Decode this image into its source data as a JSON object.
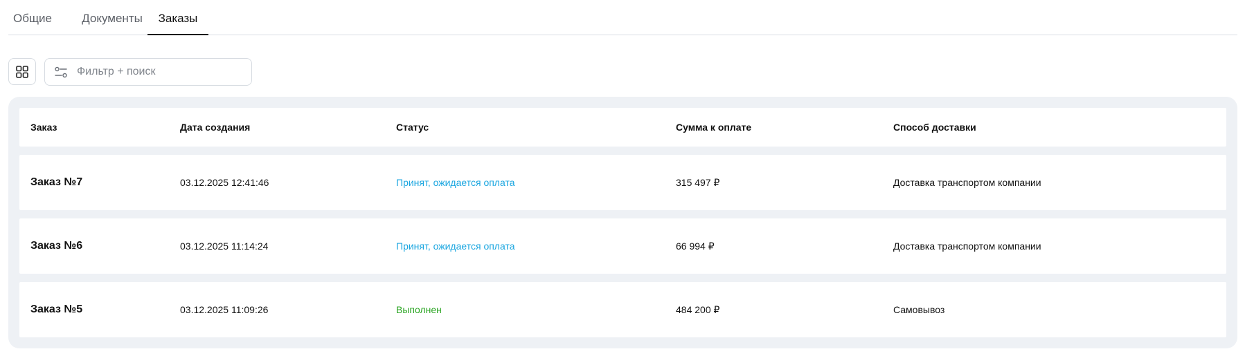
{
  "tabs": [
    {
      "label": "Общие",
      "active": false
    },
    {
      "label": "Документы",
      "active": false
    },
    {
      "label": "Заказы",
      "active": true
    }
  ],
  "toolbar": {
    "grid_icon": "grid-icon",
    "filter_icon": "filter-icon",
    "search_placeholder": "Фильтр + поиск",
    "search_value": ""
  },
  "table": {
    "columns": [
      "Заказ",
      "Дата создания",
      "Статус",
      "Сумма к оплате",
      "Способ доставки"
    ],
    "rows": [
      {
        "order": "Заказ №7",
        "date": "03.12.2025 12:41:46",
        "status": "Принят, ожидается оплата",
        "status_type": "pending",
        "amount": "315 497 ₽",
        "delivery": "Доставка транспортом компании"
      },
      {
        "order": "Заказ №6",
        "date": "03.12.2025 11:14:24",
        "status": "Принят, ожидается оплата",
        "status_type": "pending",
        "amount": "66 994 ₽",
        "delivery": "Доставка транспортом компании"
      },
      {
        "order": "Заказ №5",
        "date": "03.12.2025 11:09:26",
        "status": "Выполнен",
        "status_type": "done",
        "amount": "484 200 ₽",
        "delivery": "Самовывоз"
      }
    ]
  },
  "colors": {
    "status_pending": "#1aa6e0",
    "status_done": "#2ba523",
    "table_background": "#eef1f5",
    "tab_active_underline": "#111111"
  }
}
